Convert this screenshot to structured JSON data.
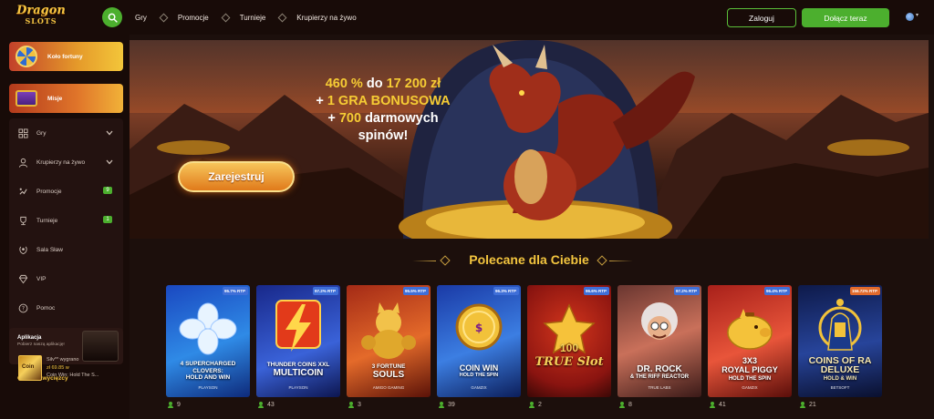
{
  "header": {
    "logo_line1": "Dragon",
    "logo_line2": "SLOTS",
    "nav": [
      "Gry",
      "Promocje",
      "Turnieje",
      "Krupierzy na żywo"
    ],
    "login_label": "Zaloguj",
    "join_label": "Dołącz teraz"
  },
  "sidebar": {
    "promos": [
      {
        "label": "Koło fortuny",
        "icon": "wheel-icon"
      },
      {
        "label": "Misje",
        "icon": "chest-icon"
      }
    ],
    "items": [
      {
        "label": "Gry",
        "icon": "slots-icon",
        "chevron": true
      },
      {
        "label": "Krupierzy na żywo",
        "icon": "dealer-icon",
        "chevron": true
      },
      {
        "label": "Promocje",
        "icon": "promo-icon",
        "badge": "9"
      },
      {
        "label": "Turnieje",
        "icon": "trophy-icon",
        "badge": "1"
      },
      {
        "label": "Sala Sław",
        "icon": "laurel-icon"
      },
      {
        "label": "VIP",
        "icon": "diamond-icon"
      },
      {
        "label": "Pomoc",
        "icon": "help-icon"
      }
    ],
    "app": {
      "title": "Aplikacja",
      "subtitle": "Pobierz naszą aplikację!"
    },
    "winners_title": "Ostatni zwycięzcy",
    "winner": {
      "thumb_label": "Coin",
      "line1": "Silv** wygrano",
      "line2": "zł 69.85 w",
      "line3": "Coin Win: Hold The S..."
    }
  },
  "hero": {
    "line1_highlight": "460 %",
    "line1_mid": " do ",
    "line1_amount": "17 200 zł",
    "line2_plus": "+ ",
    "line2_highlight": "1 GRA BONUSOWA",
    "line3_plus": "+ ",
    "line3_highlight": "700",
    "line3_rest": " darmowych",
    "line4": "spinów!",
    "cta": "Zarejestruj"
  },
  "section_title": "Polecane dla Ciebie",
  "games": [
    {
      "name_top": "4 SUPERCHARGED CLOVERS:",
      "name_bottom": "HOLD AND WIN",
      "provider": "PLAYSON",
      "rtp": "95.7% RTP",
      "players": "9",
      "colors": [
        "#1c52c9",
        "#3aa0f2"
      ]
    },
    {
      "name_top": "THUNDER COINS XXL",
      "name_bottom": "MULTICOIN",
      "provider": "PLAYSON",
      "rtp": "97.2% RTP",
      "players": "43",
      "colors": [
        "#1a2f8f",
        "#3a62d8"
      ]
    },
    {
      "name_top": "3 FORTUNE",
      "name_bottom": "SOULS",
      "provider": "AMIGO GAMING",
      "rtp": "95.5% RTP",
      "players": "3",
      "colors": [
        "#b8321a",
        "#e96a2a"
      ]
    },
    {
      "name_top": "COIN WIN",
      "name_bottom": "HOLD THE SPIN",
      "provider": "GAMZIX",
      "rtp": "96.3% RTP",
      "players": "39",
      "colors": [
        "#1f3aa8",
        "#3a7be0"
      ]
    },
    {
      "name_top": "100",
      "name_bottom": "TRUE Slot",
      "provider": "",
      "rtp": "96.6% RTP",
      "players": "2",
      "colors": [
        "#8a1410",
        "#d2351c"
      ]
    },
    {
      "name_top": "DR. ROCK",
      "name_bottom": "& THE RIFF REACTOR",
      "provider": "TRUE LABS",
      "rtp": "97.2% RTP",
      "players": "8",
      "colors": [
        "#5a2d2a",
        "#c9705a"
      ]
    },
    {
      "name_top": "3X3",
      "name_bottom": "ROYAL PIGGY",
      "sub": "HOLD THE SPIN",
      "provider": "GAMZIX",
      "rtp": "96.4% RTP",
      "players": "41",
      "colors": [
        "#b3211a",
        "#e8553a"
      ]
    },
    {
      "name_top": "COINS OF RA",
      "name_bottom": "DELUXE",
      "sub": "HOLD & WIN",
      "provider": "BETSOFT",
      "rtp": "156.72% RTP",
      "players": "21",
      "colors": [
        "#0e1a4a",
        "#27449a"
      ]
    }
  ]
}
